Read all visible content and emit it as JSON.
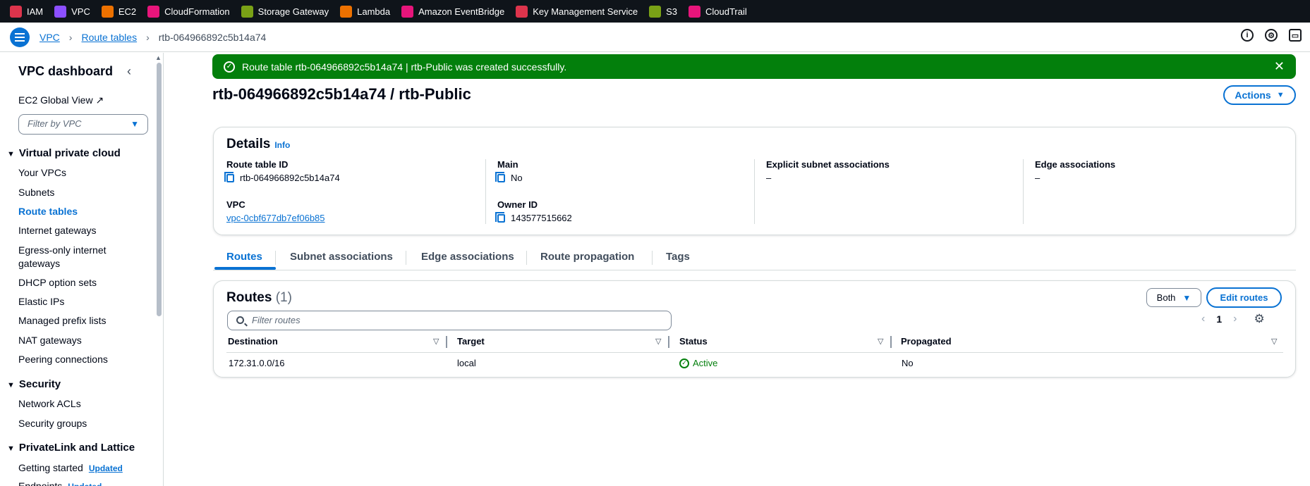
{
  "favorites": [
    {
      "label": "IAM",
      "icon": "iam-icon",
      "color": "#dd344c"
    },
    {
      "label": "VPC",
      "icon": "vpc-icon",
      "color": "#8c4fff"
    },
    {
      "label": "EC2",
      "icon": "ec2-icon",
      "color": "#ed7100"
    },
    {
      "label": "CloudFormation",
      "icon": "cloudformation-icon",
      "color": "#e7157b"
    },
    {
      "label": "Storage Gateway",
      "icon": "storage-gateway-icon",
      "color": "#7aa116"
    },
    {
      "label": "Lambda",
      "icon": "lambda-icon",
      "color": "#ed7100"
    },
    {
      "label": "Amazon EventBridge",
      "icon": "eventbridge-icon",
      "color": "#e7157b"
    },
    {
      "label": "Key Management Service",
      "icon": "kms-icon",
      "color": "#dd344c"
    },
    {
      "label": "S3",
      "icon": "s3-icon",
      "color": "#7aa116"
    },
    {
      "label": "CloudTrail",
      "icon": "cloudtrail-icon",
      "color": "#e7157b"
    }
  ],
  "breadcrumb": {
    "vpc": "VPC",
    "route_tables": "Route tables",
    "current": "rtb-064966892c5b14a74"
  },
  "sidebar": {
    "title": "VPC dashboard",
    "global_view": "EC2 Global View",
    "filter_placeholder": "Filter by VPC",
    "section_vpc": "Virtual private cloud",
    "items_vpc": [
      "Your VPCs",
      "Subnets",
      "Route tables",
      "Internet gateways",
      "Egress-only internet",
      "gateways",
      "DHCP option sets",
      "Elastic IPs",
      "Managed prefix lists",
      "NAT gateways",
      "Peering connections"
    ],
    "section_security": "Security",
    "items_security": [
      "Network ACLs",
      "Security groups"
    ],
    "section_privatelink": "PrivateLink and Lattice",
    "items_privatelink": [
      "Getting started",
      "Endpoints"
    ],
    "updated_badge": "Updated"
  },
  "flash": {
    "message": "Route table rtb-064966892c5b14a74 | rtb-Public was created successfully.",
    "color": "#037f0c"
  },
  "page": {
    "title": "rtb-064966892c5b14a74 / rtb-Public",
    "actions_label": "Actions"
  },
  "details": {
    "heading": "Details",
    "info": "Info",
    "route_table_id_label": "Route table ID",
    "route_table_id": "rtb-064966892c5b14a74",
    "main_label": "Main",
    "main": "No",
    "explicit_label": "Explicit subnet associations",
    "explicit": "–",
    "edge_label": "Edge associations",
    "edge": "–",
    "vpc_label": "VPC",
    "vpc": "vpc-0cbf677db7ef06b85",
    "owner_label": "Owner ID",
    "owner": "143577515662"
  },
  "tabs": [
    "Routes",
    "Subnet associations",
    "Edge associations",
    "Route propagation",
    "Tags"
  ],
  "routes": {
    "heading": "Routes",
    "count": "(1)",
    "both_label": "Both",
    "edit_label": "Edit routes",
    "filter_placeholder": "Filter routes",
    "page": "1",
    "columns": [
      "Destination",
      "Target",
      "Status",
      "Propagated"
    ],
    "rows": [
      {
        "destination": "172.31.0.0/16",
        "target": "local",
        "status": "Active",
        "propagated": "No"
      }
    ]
  },
  "colors": {
    "accent": "#0972d3",
    "success": "#037f0c",
    "topbar": "#0f141a"
  }
}
